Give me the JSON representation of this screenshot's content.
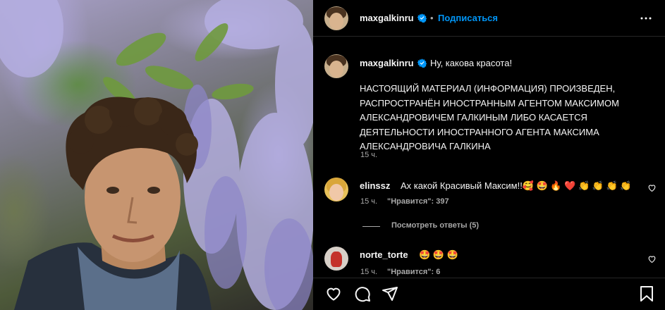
{
  "post": {
    "author": "maxgalkinru",
    "follow_label": "Подписаться",
    "dot": "•"
  },
  "caption": {
    "author": "maxgalkinru",
    "text": "Ну, какова красота!",
    "notice_lines": [
      "НАСТОЯЩИЙ МАТЕРИАЛ (ИНФОРМАЦИЯ) ПРОИЗВЕДЕН,",
      "РАСПРОСТРАНЁН ИНОСТРАННЫМ АГЕНТОМ МАКСИМОМ",
      "АЛЕКСАНДРОВИЧЕМ ГАЛКИНЫМ ЛИБО КАСАЕТСЯ",
      "ДЕЯТЕЛЬНОСТИ ИНОСТРАННОГО АГЕНТА МАКСИМА",
      "АЛЕКСАНДРОВИЧА ГАЛКИНА"
    ],
    "time": "15 ч."
  },
  "comments": [
    {
      "user": "elinssz",
      "text": "Ах какой Красивый Максим!!🥰 🤩 🔥 ❤️ 👏 👏 👏 👏",
      "time": "15 ч.",
      "likes": "\"Нравится\": 397"
    },
    {
      "user": "norte_torte",
      "text": "🤩 🤩 🤩",
      "time": "15 ч.",
      "likes": "\"Нравится\": 6"
    }
  ],
  "replies_label": "Посмотреть ответы (5)",
  "icons": {
    "verified": "verified-badge-icon",
    "more": "more-options-icon",
    "like": "heart-icon",
    "comment": "comment-icon",
    "share": "share-icon",
    "save": "bookmark-icon"
  },
  "colors": {
    "background": "#000000",
    "accent": "#0095f6",
    "secondary_text": "#a8a8a8",
    "divider": "#262626"
  }
}
